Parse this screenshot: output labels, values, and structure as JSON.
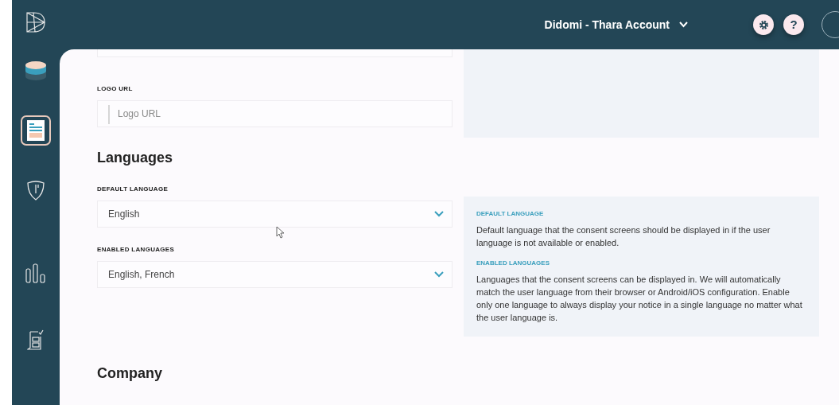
{
  "sidebar": {
    "items": [
      {
        "selected": false
      },
      {
        "selected": true
      },
      {
        "selected": false
      },
      {
        "selected": false
      },
      {
        "selected": false
      }
    ]
  },
  "topbar": {
    "account": "Didomi - Thara Account",
    "buttons": [
      {
        "kind": "settings"
      },
      {
        "kind": "help",
        "label": "?"
      }
    ]
  },
  "form": {
    "fields": [
      {
        "kind": "cut-input"
      },
      {
        "kind": "input",
        "label": "LOGO URL",
        "placeholder": "Logo URL"
      },
      {
        "kind": "heading",
        "label": "Languages"
      },
      {
        "kind": "select",
        "label": "DEFAULT LANGUAGE",
        "value": "English"
      },
      {
        "kind": "select",
        "label": "ENABLED LANGUAGES",
        "value": "English, French"
      },
      {
        "kind": "heading",
        "label": "Company"
      }
    ]
  },
  "help": {
    "items": [
      {
        "title": "DEFAULT LANGUAGE",
        "text": "Default language that the consent screens should be displayed in if the user language is not available or enabled."
      },
      {
        "title": "ENABLED LANGUAGES",
        "text": "Languages that the consent screens can be displayed in. We will automatically match the user language from their browser or Android/iOS configuration. Enable only one language to always display your notice in a single language no matter what the user language is."
      }
    ]
  }
}
